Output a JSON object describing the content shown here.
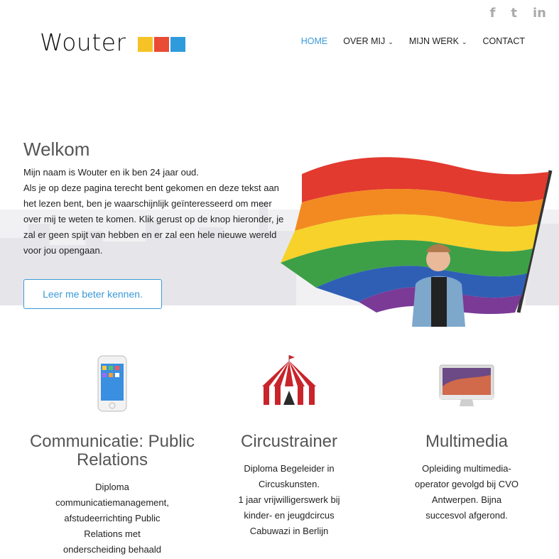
{
  "social": {
    "facebook": "f",
    "twitter": "t",
    "linkedin": "in"
  },
  "logo": {
    "text": "Wouter",
    "squares": [
      "#f6c327",
      "#e94b35",
      "#2e9cdc"
    ]
  },
  "nav": {
    "home": "HOME",
    "about": "OVER MIJ",
    "work": "MIJN WERK",
    "contact": "CONTACT",
    "accent": "#3a9ad9"
  },
  "hero": {
    "title": "Welkom",
    "lines": [
      "Mijn naam is Wouter en ik ben 24 jaar oud.",
      "Als je op deze pagina terecht bent gekomen en deze tekst aan",
      "het lezen bent, ben je waarschijnlijk geïnteresseerd om meer",
      "over mij te weten te komen. Klik gerust op de knop hieronder, je",
      "zal er geen spijt van hebben en er zal een hele nieuwe wereld",
      "voor jou opengaan."
    ],
    "button": "Leer me beter kennen."
  },
  "features": [
    {
      "icon": "iphone-icon",
      "title": [
        "Communicatie: Public",
        "Relations"
      ],
      "desc": [
        "Diploma",
        "communicatiemanagement,",
        "afstudeerrichting Public",
        "Relations met",
        "onderscheiding behaald"
      ]
    },
    {
      "icon": "circus-tent-icon",
      "title": [
        "Circustrainer"
      ],
      "desc": [
        "Diploma Begeleider in",
        "Circuskunsten.",
        "1 jaar vrijwilligerswerk bij",
        "kinder- en jeugdcircus",
        "Cabuwazi in Berlijn"
      ]
    },
    {
      "icon": "imac-icon",
      "title": [
        "Multimedia"
      ],
      "desc": [
        "Opleiding multimedia-",
        "operator gevolgd bij CVO",
        "Antwerpen. Bijna",
        "succesvol afgerond."
      ]
    }
  ]
}
